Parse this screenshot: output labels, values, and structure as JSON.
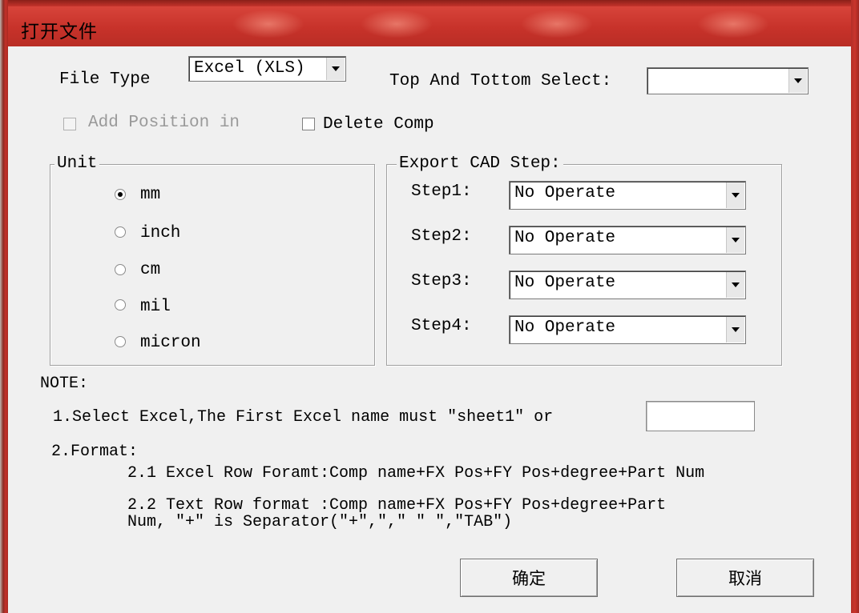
{
  "window": {
    "title": "打开文件"
  },
  "top": {
    "file_type_label": "File Type",
    "file_type_value": "Excel (XLS)",
    "top_bottom_label": "Top And Tottom Select:",
    "top_bottom_value": "",
    "add_position_label": "Add Position in",
    "add_position_checked": false,
    "add_position_enabled": false,
    "delete_comp_label": "Delete Comp",
    "delete_comp_checked": false
  },
  "unit": {
    "legend": "Unit",
    "options": [
      "mm",
      "inch",
      "cm",
      "mil",
      "micron"
    ],
    "selected": "mm"
  },
  "export": {
    "legend": "Export CAD Step:",
    "steps": [
      {
        "label": "Step1:",
        "value": "No Operate"
      },
      {
        "label": "Step2:",
        "value": "No Operate"
      },
      {
        "label": "Step3:",
        "value": "No Operate"
      },
      {
        "label": "Step4:",
        "value": "No Operate"
      }
    ]
  },
  "note": {
    "header": "NOTE:",
    "line1": "1.Select Excel,The First Excel name must ″sheet1″ or",
    "sheet_name_value": "",
    "line2": "2.Format:",
    "line2_1": "2.1 Excel Row Foramt:Comp name+FX Pos+FY Pos+degree+Part Num",
    "line2_2a": "2.2 Text Row format :Comp name+FX Pos+FY Pos+degree+Part",
    "line2_2b": "Num, ″+″ is Separator(″+″,″,″ ″ ″,″TAB″)"
  },
  "buttons": {
    "ok": "确定",
    "cancel": "取消"
  },
  "colors": {
    "titlebar": "#c7322a",
    "dialog_bg": "#f0f0f0"
  }
}
